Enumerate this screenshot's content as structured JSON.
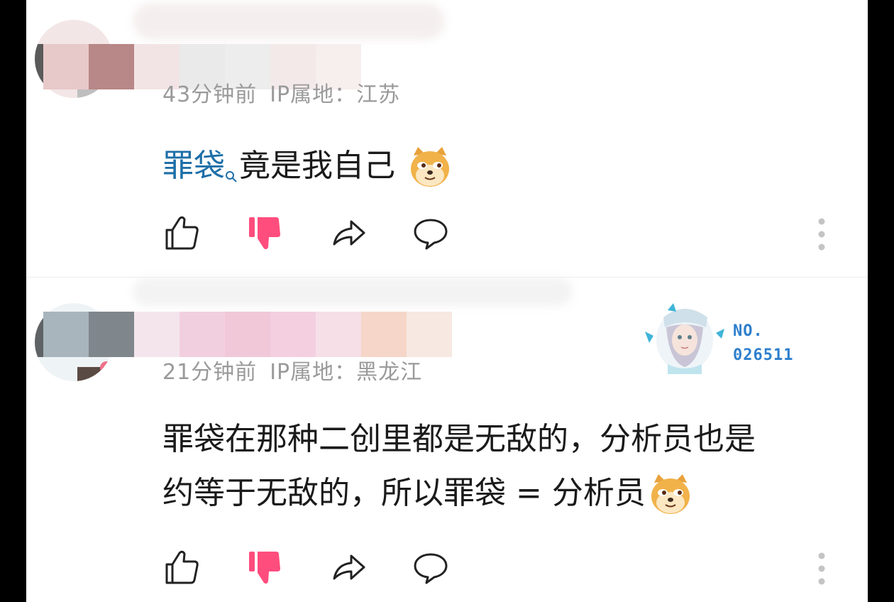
{
  "comments": [
    {
      "meta_time": "43分钟前",
      "meta_ip": "IP属地：江苏",
      "link_text": "罪袋",
      "text": "竟是我自己",
      "emoji": "doge-emoji"
    },
    {
      "meta_time": "21分钟前",
      "meta_ip": "IP属地：黑龙江",
      "line1": "罪袋在那种二创里都是无敌的，分析员也是",
      "line2": "约等于无敌的，所以罪袋 = 分析员",
      "emoji": "doge-emoji",
      "badge_label": "NO.",
      "badge_number": "026511"
    }
  ],
  "icons": {
    "like": "thumbs-up-icon",
    "dislike": "thumbs-down-icon",
    "share": "share-icon",
    "reply": "comment-icon",
    "more": "more-vertical-icon",
    "search": "search-icon"
  },
  "colors": {
    "link": "#1e6fa8",
    "dislike_active": "#ff4d7d",
    "meta": "#9a9a9a",
    "badge": "#2e7fcc"
  }
}
